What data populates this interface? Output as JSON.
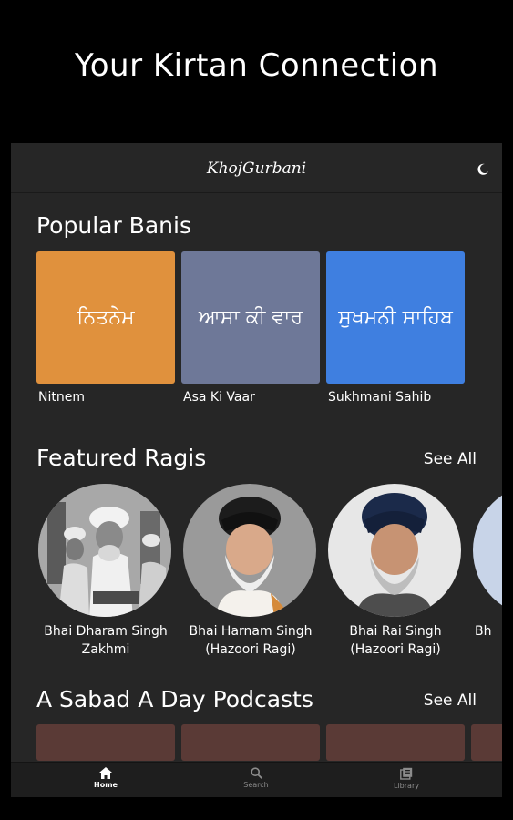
{
  "headline": "Your Kirtan Connection",
  "app": {
    "logo": "KhojGurbani",
    "theme_icon": "moon-icon"
  },
  "popular_banis": {
    "title": "Popular Banis",
    "items": [
      {
        "gurmukhi": "ਨਿਤਨੇਮ",
        "label": "Nitnem",
        "color": "#e0913d"
      },
      {
        "gurmukhi": "ਆਸਾ ਕੀ ਵਾਰ",
        "label": "Asa Ki Vaar",
        "color": "#6e7898"
      },
      {
        "gurmukhi": "ਸੁਖਮਨੀ ਸਾਹਿਬ",
        "label": "Sukhmani Sahib",
        "color": "#3f7fe0"
      }
    ]
  },
  "featured_ragis": {
    "title": "Featured Ragis",
    "see_all": "See All",
    "items": [
      {
        "name": "Bhai Dharam Singh Zakhmi"
      },
      {
        "name": "Bhai Harnam Singh (Hazoori Ragi)"
      },
      {
        "name": "Bhai Rai Singh (Hazoori Ragi)"
      },
      {
        "name": "Bh"
      }
    ]
  },
  "podcasts": {
    "title": "A Sabad A Day Podcasts",
    "see_all": "See All"
  },
  "bottom_nav": {
    "items": [
      {
        "label": "Home",
        "icon": "home-icon",
        "active": true
      },
      {
        "label": "Search",
        "icon": "search-icon",
        "active": false
      },
      {
        "label": "Library",
        "icon": "library-icon",
        "active": false
      }
    ]
  }
}
